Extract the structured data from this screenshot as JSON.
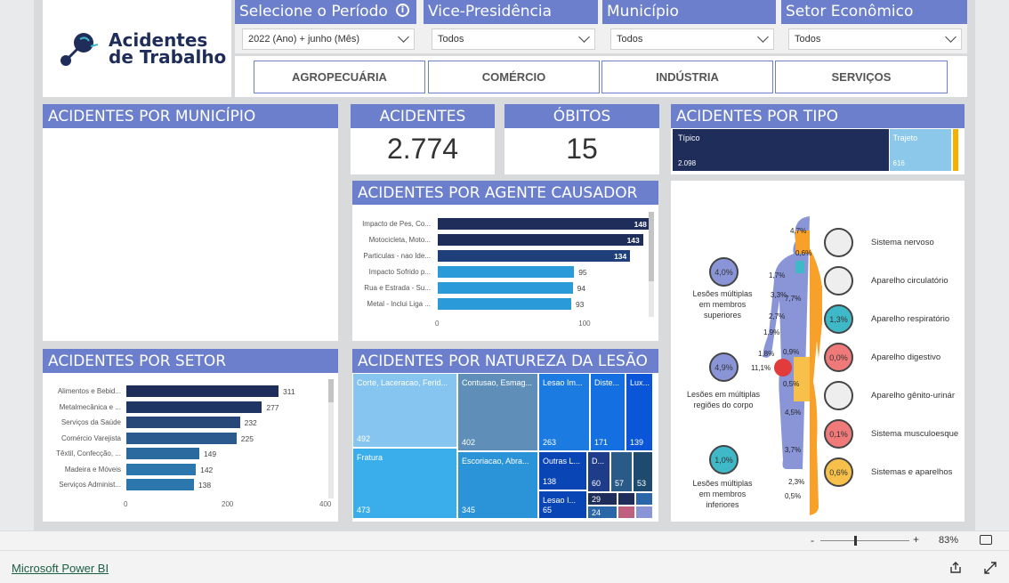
{
  "logo": {
    "line1": "Acidentes",
    "line2": "de Trabalho"
  },
  "filters": {
    "periodo": {
      "title": "Selecione o Período",
      "value": "2022 (Ano) + junho (Mês)"
    },
    "vice": {
      "title": "Vice-Presidência",
      "value": "Todos"
    },
    "municipio": {
      "title": "Município",
      "value": "Todos"
    },
    "setor": {
      "title": "Setor Econômico",
      "value": "Todos"
    }
  },
  "segments": [
    "AGROPECUÁRIA",
    "COMÉRCIO",
    "INDÚSTRIA",
    "SERVIÇOS"
  ],
  "titles": {
    "municipio": "ACIDENTES POR MUNICÍPIO",
    "setor": "ACIDENTES POR SETOR",
    "agente": "ACIDENTES POR AGENTE CAUSADOR",
    "natureza": "ACIDENTES POR NATUREZA DA LESÃO",
    "tipo": "ACIDENTES POR TIPO"
  },
  "kpis": {
    "acidentes": {
      "label": "ACIDENTES",
      "value": "2.774"
    },
    "obitos": {
      "label": "ÓBITOS",
      "value": "15"
    }
  },
  "tipo": {
    "tipico": {
      "label": "Típico",
      "value": "2.098",
      "amount": 2098
    },
    "trajeto": {
      "label": "Trajeto",
      "value": "616",
      "amount": 616
    }
  },
  "chart_data": [
    {
      "type": "bar",
      "id": "agente",
      "title": "ACIDENTES POR AGENTE CAUSADOR",
      "categories": [
        "Impacto de Pes, Co...",
        "Motocicleta, Moto...",
        "Particulas - nao Ide...",
        "Impacto Sofrido p...",
        "Rua e Estrada - Su...",
        "Metal - Inclui Liga ..."
      ],
      "values": [
        148,
        143,
        134,
        95,
        94,
        93
      ],
      "colors": [
        "#1f2d5a",
        "#1f2d5a",
        "#1f3f7a",
        "#2a9bd8",
        "#2a9bd8",
        "#2a9bd8"
      ],
      "xticks": [
        0,
        100
      ],
      "xlim": [
        0,
        160
      ]
    },
    {
      "type": "bar",
      "id": "setor",
      "title": "ACIDENTES POR SETOR",
      "categories": [
        "Alimentos e Bebid...",
        "Metalmecânica e ...",
        "Serviços da Saúde",
        "Comércio Varejista",
        "Têxtil, Confecção, ...",
        "Madeira e Móveis",
        "Serviços Administ..."
      ],
      "values": [
        311,
        277,
        232,
        225,
        149,
        142,
        138
      ],
      "colors": [
        "#1f2d5a",
        "#1f3563",
        "#264778",
        "#2a5a8e",
        "#2b6a9e",
        "#2b76ad",
        "#2b76ad"
      ],
      "xticks": [
        0,
        200,
        400
      ],
      "xlim": [
        0,
        400
      ]
    },
    {
      "type": "treemap",
      "id": "natureza",
      "title": "ACIDENTES POR NATUREZA DA LESÃO",
      "labels": [
        "Corte, Laceracao, Ferid...",
        "Fratura",
        "Contusao, Esmag...",
        "Escoriacao, Abra...",
        "Lesao Im...",
        "Outras L...",
        "Lesao I...",
        "Diste...",
        "Lux...",
        "D...",
        "",
        "",
        "",
        ""
      ],
      "values": [
        492,
        473,
        402,
        345,
        263,
        138,
        65,
        171,
        139,
        60,
        57,
        53,
        29,
        24
      ]
    }
  ],
  "body_systems": [
    {
      "name": "Sistema nervoso",
      "pct": "",
      "color": "#eeeeee"
    },
    {
      "name": "Aparelho circulatório",
      "pct": "",
      "color": "#eeeeee"
    },
    {
      "name": "Aparelho respiratório",
      "pct": "1,3%",
      "color": "#3fb8c8"
    },
    {
      "name": "Aparelho digestivo",
      "pct": "0,0%",
      "color": "#f07a7a"
    },
    {
      "name": "Aparelho gênito-urinár",
      "pct": "",
      "color": "#eeeeee"
    },
    {
      "name": "Sistema musculoesque",
      "pct": "0,1%",
      "color": "#f07a7a"
    },
    {
      "name": "Sistemas e aparelhos",
      "pct": "0,6%",
      "color": "#f6c04a"
    }
  ],
  "body_regions": [
    {
      "name": "Lesões múltiplas em membros superiores",
      "pct": "4,0%",
      "color": "#8a95d8"
    },
    {
      "name": "Lesões em múltiplas regiões do corpo",
      "pct": "4,9%",
      "color": "#8a95d8"
    },
    {
      "name": "Lesões múltiplas em membros inferiores",
      "pct": "1,0%",
      "color": "#3fb8c8"
    }
  ],
  "body_labels": [
    "4,7%",
    "0,6%",
    "1,7%",
    "3,3%",
    "7,7%",
    "2,7%",
    "1,9%",
    "1,8%",
    "11,1%",
    "0,9%",
    "0,5%",
    "4,5%",
    "3,7%",
    "2,3%",
    "0,5%"
  ],
  "status": {
    "zoom": "83%",
    "minus": "-",
    "plus": "+"
  },
  "footer": {
    "brand": "Microsoft Power BI"
  }
}
